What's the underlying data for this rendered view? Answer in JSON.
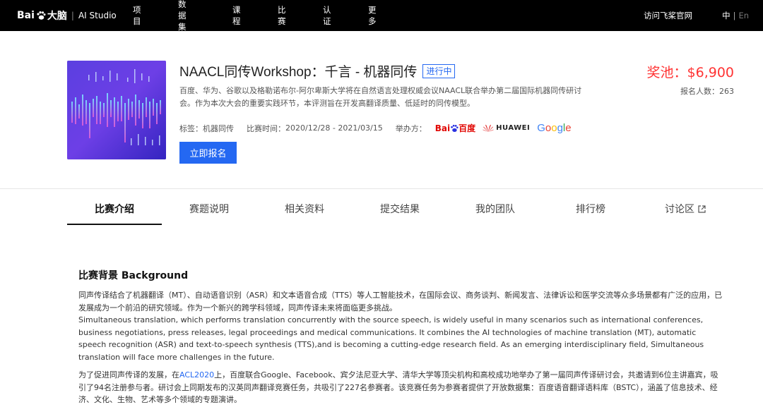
{
  "brand": {
    "logo_text": "Bai",
    "logo_cn": "大脑",
    "separator": "|",
    "product": "AI Studio"
  },
  "nav": {
    "items": [
      "项目",
      "数据集",
      "课程",
      "比赛",
      "认证",
      "更多"
    ],
    "visit": "访问飞桨官网",
    "lang_active": "中",
    "lang_sep": "|",
    "lang_other": "En"
  },
  "competition": {
    "title": "NAACL同传Workshop：千言 - 机器同传",
    "status": "进行中",
    "description": "百度、华为、谷歌以及格勒诺布尔-阿尔卑斯大学将在自然语言处理权威会议NAACL联合举办第二届国际机器同传研讨会。作为本次大会的重要实践环节，本评测旨在开发高翻译质量、低延时的同传模型。",
    "tag_label": "标签：",
    "tag_value": "机器同传",
    "time_label": "比赛时间：",
    "time_value": "2020/12/28 - 2021/03/15",
    "organizer_label": "举办方：",
    "organizers": {
      "baidu_bai": "Bai",
      "baidu_cn": "百度",
      "huawei": "HUAWEI",
      "google": "Google"
    },
    "signup_button": "立即报名",
    "prize_label": "奖池：",
    "prize_value": "$6,900",
    "signups_label": "报名人数：",
    "signups_value": "263"
  },
  "tabs": [
    "比赛介绍",
    "赛题说明",
    "相关资料",
    "提交结果",
    "我的团队",
    "排行榜",
    "讨论区"
  ],
  "active_tab": "比赛介绍",
  "content": {
    "section_title": "比赛背景 Background",
    "para1": "同声传译结合了机器翻译（MT）、自动语音识别（ASR）和文本语音合成（TTS）等人工智能技术，在国际会议、商务谈判、新闻发言、法律诉讼和医学交流等众多场景都有广泛的应用，已发展成为一个前沿的研究领域。作为一个新兴的跨学科领域，同声传译未来将面临更多挑战。",
    "para2": "Simultaneous translation, which performs translation concurrently with the source speech, is widely useful in many scenarios such as international conferences, business negotiations, press releases, legal proceedings and medical communications. It combines the AI technologies of machine translation (MT), automatic speech recognition (ASR) and text-to-speech synthesis (TTS),and is becoming a cutting-edge research field. As an emerging interdisciplinary field, Simultaneous translation will face more challenges in the future.",
    "para3_before": "为了促进同声传译的发展，在",
    "para3_link": "ACL2020",
    "para3_after": "上，百度联合Google、Facebook、宾夕法尼亚大学、清华大学等顶尖机构和高校成功地举办了第一届同声传译研讨会，共邀请到6位主讲嘉宾，吸引了94名注册参与者。研讨会上同期发布的汉英同声翻译竞赛任务，共吸引了227名参赛者。该竞赛任务为参赛者提供了开放数据集：百度语音翻译语料库（BSTC），涵盖了信息技术、经济、文化、生物、艺术等多个领域的专题演讲。"
  },
  "colors": {
    "accent": "#2468f2",
    "prize": "#ff3333",
    "topbar": "#000000"
  }
}
